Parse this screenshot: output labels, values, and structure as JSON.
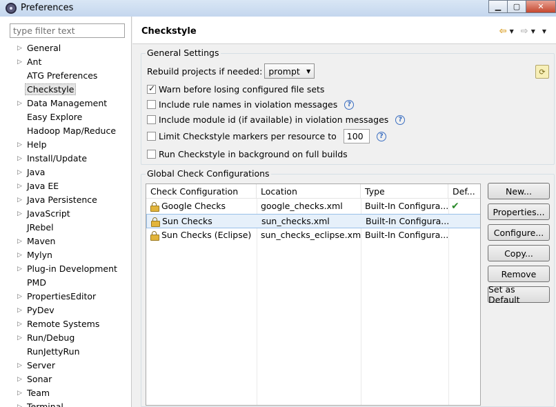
{
  "window": {
    "title": "Preferences",
    "minimize_glyph": "▁",
    "maximize_glyph": "▢",
    "close_glyph": "✕"
  },
  "filter": {
    "placeholder": "type filter text",
    "value": ""
  },
  "tree": {
    "items": [
      {
        "label": "General",
        "expandable": true
      },
      {
        "label": "Ant",
        "expandable": true
      },
      {
        "label": "ATG Preferences",
        "expandable": false
      },
      {
        "label": "Checkstyle",
        "expandable": false,
        "selected": true
      },
      {
        "label": "Data Management",
        "expandable": true
      },
      {
        "label": "Easy Explore",
        "expandable": false
      },
      {
        "label": "Hadoop Map/Reduce",
        "expandable": false
      },
      {
        "label": "Help",
        "expandable": true
      },
      {
        "label": "Install/Update",
        "expandable": true
      },
      {
        "label": "Java",
        "expandable": true
      },
      {
        "label": "Java EE",
        "expandable": true
      },
      {
        "label": "Java Persistence",
        "expandable": true
      },
      {
        "label": "JavaScript",
        "expandable": true
      },
      {
        "label": "JRebel",
        "expandable": false
      },
      {
        "label": "Maven",
        "expandable": true
      },
      {
        "label": "Mylyn",
        "expandable": true
      },
      {
        "label": "Plug-in Development",
        "expandable": true
      },
      {
        "label": "PMD",
        "expandable": false
      },
      {
        "label": "PropertiesEditor",
        "expandable": true
      },
      {
        "label": "PyDev",
        "expandable": true
      },
      {
        "label": "Remote Systems",
        "expandable": true
      },
      {
        "label": "Run/Debug",
        "expandable": true
      },
      {
        "label": "RunJettyRun",
        "expandable": false
      },
      {
        "label": "Server",
        "expandable": true
      },
      {
        "label": "Sonar",
        "expandable": true
      },
      {
        "label": "Team",
        "expandable": true
      },
      {
        "label": "Terminal",
        "expandable": true
      }
    ]
  },
  "page": {
    "title": "Checkstyle",
    "nav": {
      "back_glyph": "⇦",
      "forward_glyph": "⇨",
      "dropdown_glyph": "▼"
    }
  },
  "general": {
    "legend": "General Settings",
    "rebuild_label": "Rebuild projects if needed:",
    "rebuild_value": "prompt",
    "caret": "▼",
    "refresh_glyph": "⟳",
    "options": [
      {
        "label": "Warn before losing configured file sets",
        "checked": true
      },
      {
        "label": "Include rule names in violation messages",
        "checked": false,
        "help": "?"
      },
      {
        "label": "Include module id (if available) in violation messages",
        "checked": false,
        "help": "?"
      },
      {
        "label": "Limit Checkstyle markers per resource to",
        "checked": false,
        "help": "?",
        "value": "100"
      },
      {
        "label": "Run Checkstyle in background on full builds",
        "checked": false
      }
    ]
  },
  "global": {
    "legend": "Global Check Configurations",
    "columns": [
      "Check Configuration",
      "Location",
      "Type",
      "Def..."
    ],
    "rows": [
      {
        "name": "Google Checks",
        "location": "google_checks.xml",
        "type": "Built-In Configura...",
        "default": "✔",
        "selected": false
      },
      {
        "name": "Sun Checks",
        "location": "sun_checks.xml",
        "type": "Built-In Configura...",
        "default": "",
        "selected": true
      },
      {
        "name": "Sun Checks (Eclipse)",
        "location": "sun_checks_eclipse.xml",
        "type": "Built-In Configura...",
        "default": "",
        "selected": false
      }
    ],
    "buttons": [
      "New...",
      "Properties...",
      "Configure...",
      "Copy...",
      "Remove",
      "Set as Default"
    ]
  },
  "colors": {
    "selection_bg": "#e6f0fa",
    "selection_border": "#99c0e8",
    "help_blue": "#3a6ec1",
    "check_green": "#2a8a2a"
  }
}
